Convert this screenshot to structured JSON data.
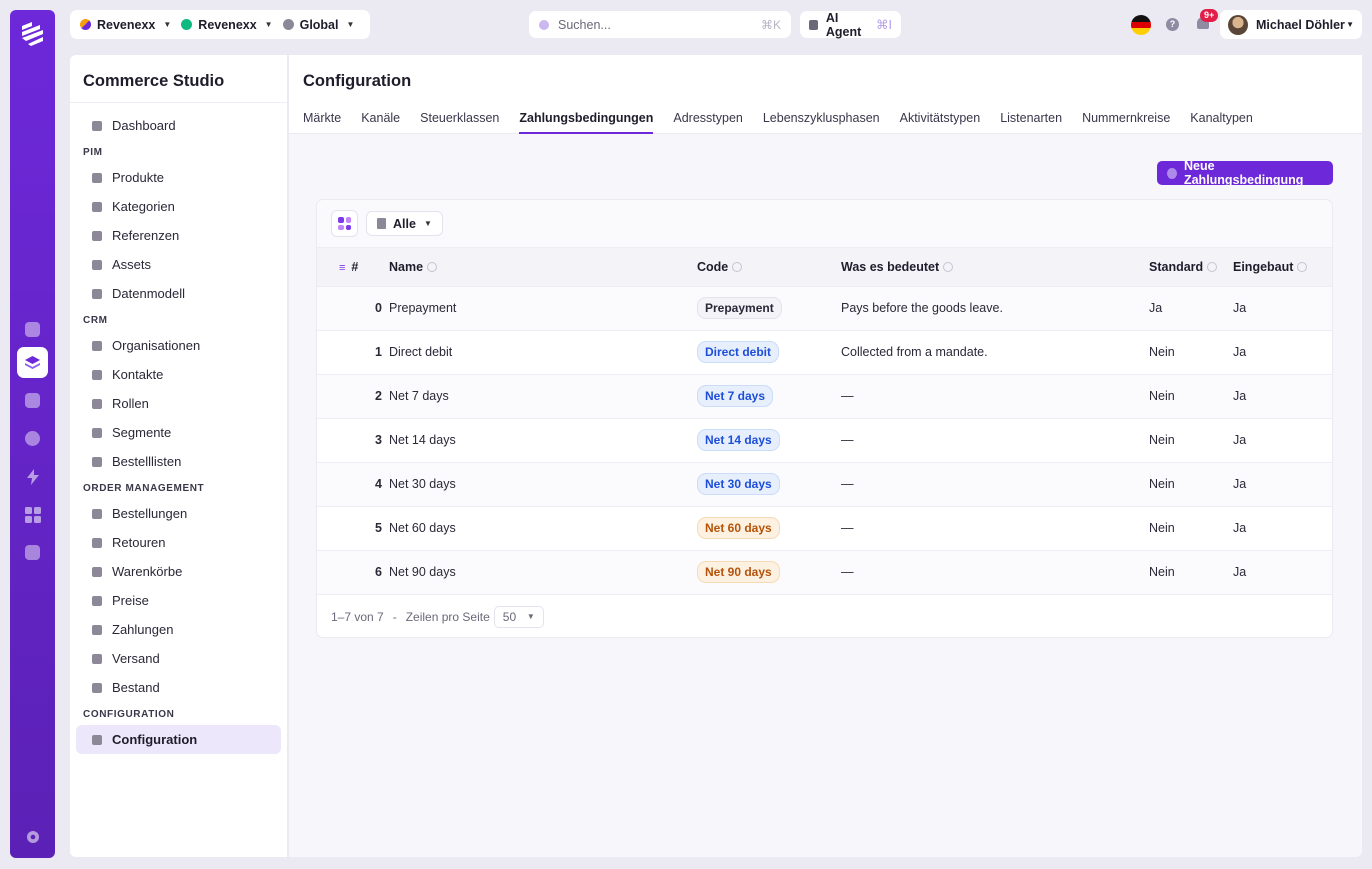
{
  "topbar": {
    "org1": "Revenexx",
    "org2": "Revenexx",
    "scope": "Global",
    "search_placeholder": "Suchen...",
    "search_shortcut": "⌘K",
    "agent_label": "AI Agent",
    "agent_shortcut": "⌘I",
    "notif_badge": "9+",
    "user_name": "Michael Döhler"
  },
  "sidebar": {
    "app_title": "Commerce Studio",
    "dashboard": "Dashboard",
    "sections": [
      {
        "title": "PIM",
        "items": [
          "Produkte",
          "Kategorien",
          "Referenzen",
          "Assets",
          "Datenmodell"
        ]
      },
      {
        "title": "CRM",
        "items": [
          "Organisationen",
          "Kontakte",
          "Rollen",
          "Segmente",
          "Bestelllisten"
        ]
      },
      {
        "title": "ORDER MANAGEMENT",
        "items": [
          "Bestellungen",
          "Retouren",
          "Warenkörbe",
          "Preise",
          "Zahlungen",
          "Versand",
          "Bestand"
        ]
      },
      {
        "title": "CONFIGURATION",
        "items": [
          "Configuration"
        ]
      }
    ]
  },
  "main": {
    "title": "Configuration",
    "tabs": [
      "Märkte",
      "Kanäle",
      "Steuerklassen",
      "Zahlungsbedingungen",
      "Adresstypen",
      "Lebenszyklusphasen",
      "Aktivitätstypen",
      "Listenarten",
      "Nummernkreise",
      "Kanaltypen"
    ],
    "active_tab": 3,
    "new_button": "Neue Zahlungsbedingung",
    "filter_label": "Alle",
    "columns": {
      "num": "#",
      "name": "Name",
      "code": "Code",
      "meaning": "Was es bedeutet",
      "standard": "Standard",
      "builtin": "Eingebaut"
    },
    "rows": [
      {
        "num": "0",
        "name": "Prepayment",
        "code": "Prepayment",
        "tone": "gray",
        "meaning": "Pays before the goods leave.",
        "standard": "Ja",
        "builtin": "Ja"
      },
      {
        "num": "1",
        "name": "Direct debit",
        "code": "Direct debit",
        "tone": "blue",
        "meaning": "Collected from a mandate.",
        "standard": "Nein",
        "builtin": "Ja"
      },
      {
        "num": "2",
        "name": "Net 7 days",
        "code": "Net 7 days",
        "tone": "blue",
        "meaning": "—",
        "standard": "Nein",
        "builtin": "Ja"
      },
      {
        "num": "3",
        "name": "Net 14 days",
        "code": "Net 14 days",
        "tone": "blue",
        "meaning": "—",
        "standard": "Nein",
        "builtin": "Ja"
      },
      {
        "num": "4",
        "name": "Net 30 days",
        "code": "Net 30 days",
        "tone": "blue",
        "meaning": "—",
        "standard": "Nein",
        "builtin": "Ja"
      },
      {
        "num": "5",
        "name": "Net 60 days",
        "code": "Net 60 days",
        "tone": "orange",
        "meaning": "—",
        "standard": "Nein",
        "builtin": "Ja"
      },
      {
        "num": "6",
        "name": "Net 90 days",
        "code": "Net 90 days",
        "tone": "orange",
        "meaning": "—",
        "standard": "Nein",
        "builtin": "Ja"
      }
    ],
    "pagination": {
      "range": "1–7 von 7",
      "separator": "-",
      "rows_label": "Zeilen pro Seite",
      "page_size": "50"
    }
  },
  "colors": {
    "accent": "#6d28d9",
    "rail": "#5b21b6"
  }
}
